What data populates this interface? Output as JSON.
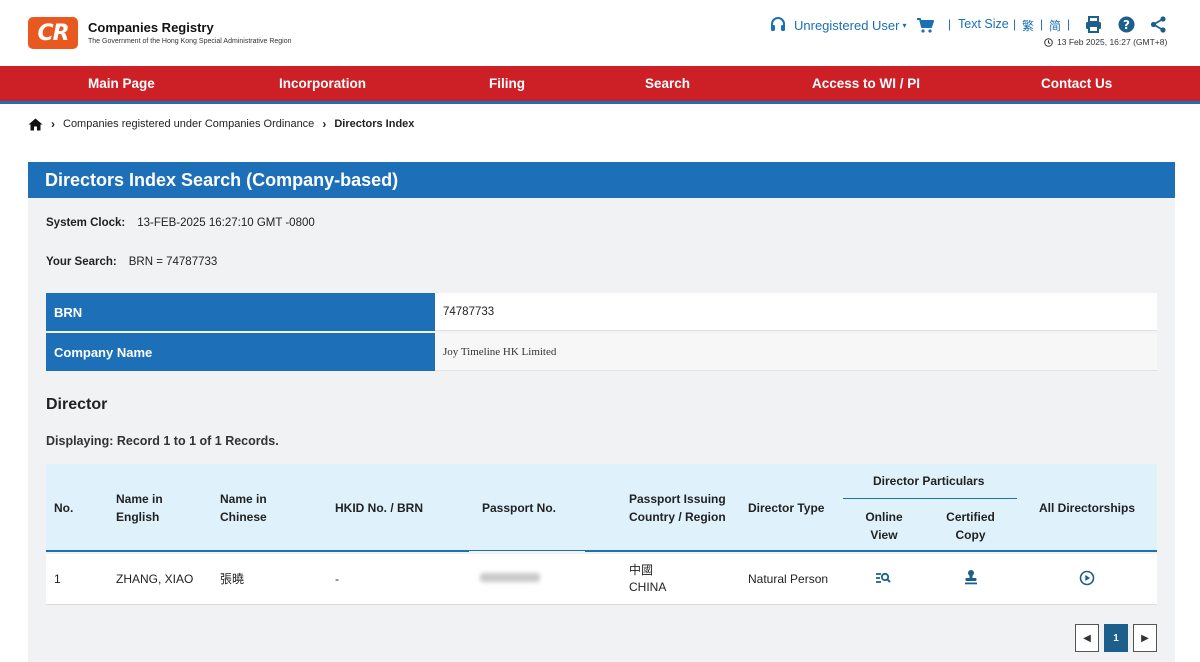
{
  "header": {
    "logo_text": "CR",
    "brand_title": "Companies Registry",
    "brand_subtitle": "The Government of the Hong Kong Special Administrative Region",
    "user_label": "Unregistered User",
    "text_size_label": "Text Size",
    "lang_traditional": "繁",
    "lang_simplified": "简",
    "datetime": "13 Feb 2025, 16:27 (GMT+8)"
  },
  "nav": {
    "items": [
      {
        "label": "Main Page"
      },
      {
        "label": "Incorporation"
      },
      {
        "label": "Filing"
      },
      {
        "label": "Search"
      },
      {
        "label": "Access to WI / PI"
      },
      {
        "label": "Contact Us"
      }
    ]
  },
  "breadcrumb": {
    "parent": "Companies registered under Companies Ordinance",
    "current": "Directors Index"
  },
  "panel": {
    "title": "Directors Index Search (Company-based)",
    "system_clock_label": "System Clock:",
    "system_clock_value": "13-FEB-2025 16:27:10 GMT -0800",
    "your_search_label": "Your Search:",
    "your_search_value": "BRN = 74787733",
    "brn_label": "BRN",
    "brn_value": "74787733",
    "company_name_label": "Company Name",
    "company_name_value": "Joy Timeline HK Limited",
    "section_title": "Director",
    "displaying": "Displaying: Record 1 to 1 of 1 Records."
  },
  "table": {
    "headers": {
      "no": "No.",
      "name_en_1": "Name in",
      "name_en_2": "English",
      "name_zh_1": "Name in",
      "name_zh_2": "Chinese",
      "hkid": "HKID No. / BRN",
      "passport": "Passport No.",
      "country_1": "Passport Issuing",
      "country_2": "Country / Region",
      "director_type": "Director Type",
      "director_particulars": "Director Particulars",
      "online_1": "Online",
      "online_2": "View",
      "certified_1": "Certified",
      "certified_2": "Copy",
      "all_directorships": "All Directorships"
    },
    "rows": [
      {
        "no": "1",
        "name_en": "ZHANG, XIAO",
        "name_zh": "張曉",
        "hkid": "-",
        "country_zh": "中國",
        "country_en": "CHINA",
        "director_type": "Natural Person"
      }
    ]
  },
  "pagination": {
    "current_page": "1"
  },
  "colors": {
    "nav_red": "#cd1f26",
    "panel_blue": "#1d70b8",
    "logo_orange": "#e9591f",
    "table_header_bg": "#dff2fb"
  }
}
